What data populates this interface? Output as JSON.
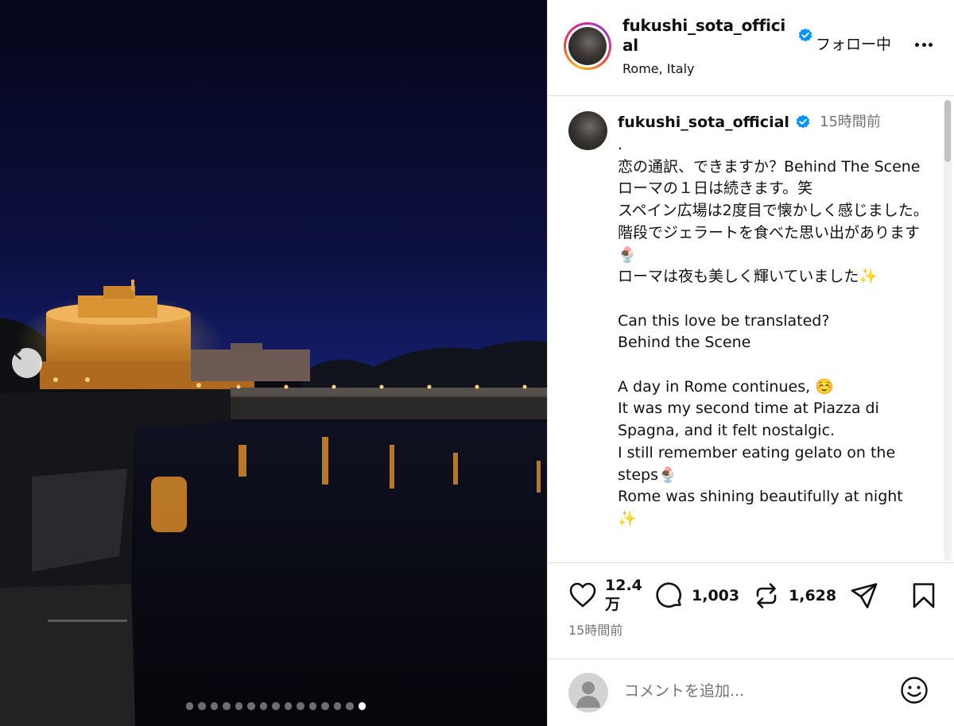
{
  "post": {
    "username": "fukushi_sota_official",
    "location": "Rome, Italy",
    "follow_label": "フォロー中",
    "verified_color": "#0095f6"
  },
  "photo": {
    "slide_count": 15,
    "active_slide": 15
  },
  "caption": {
    "username": "fukushi_sota_official",
    "time": "15時間前",
    "text": ".\n恋の通訳、できますか？Behind The Scene\nローマの１日は続きます。笑\nスペイン広場は2度目で懐かしく感じました。階段でジェラートを食べた思い出があります🍨\nローマは夜も美しく輝いていました✨\n\nCan this love be translated?\nBehind the Scene\n\nA day in Rome continues, ☺️\nIt was my second time at Piazza di Spagna, and it felt nostalgic.\nI still remember eating gelato on the steps🍨\nRome was shining beautifully at night\n✨"
  },
  "actions": {
    "likes": "12.4\n万",
    "comments": "1,003",
    "reposts": "1,628",
    "timestamp": "15時間前"
  },
  "comment_box": {
    "placeholder": "コメントを追加..."
  }
}
